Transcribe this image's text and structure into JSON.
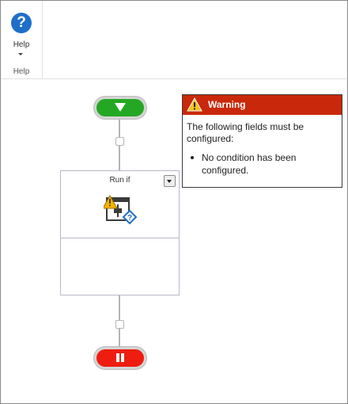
{
  "ribbon": {
    "help_button_label": "Help",
    "help_group_label": "Help",
    "help_icon": "question-mark-icon"
  },
  "workflow": {
    "activity": {
      "title": "Run if",
      "icon": "run-if-activity-icon"
    },
    "start_icon": "triangle-down-icon",
    "end_icon": "stop-icon"
  },
  "warning": {
    "title": "Warning",
    "message": "The following fields must be configured:",
    "items": [
      "No condition has been configured."
    ]
  },
  "colors": {
    "start": "#24a823",
    "end": "#ee1d0f",
    "warning_header": "#c9290a",
    "help_icon": "#1e6fc9"
  }
}
